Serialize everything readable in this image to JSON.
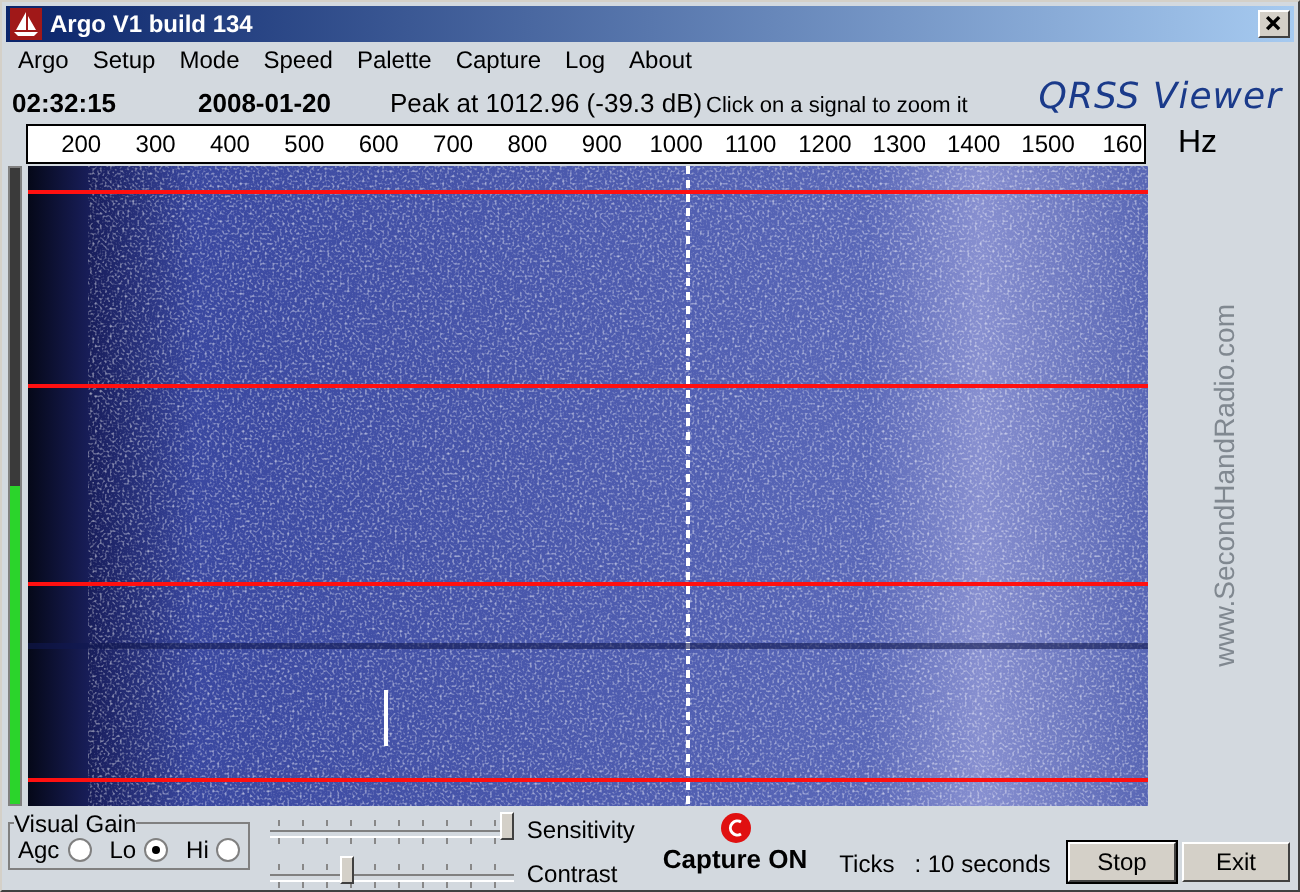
{
  "window": {
    "title": "Argo V1 build 134"
  },
  "menu": [
    {
      "label": "Argo"
    },
    {
      "label": "Setup"
    },
    {
      "label": "Mode"
    },
    {
      "label": "Speed"
    },
    {
      "label": "Palette"
    },
    {
      "label": "Capture"
    },
    {
      "label": "Log"
    },
    {
      "label": "About"
    }
  ],
  "info": {
    "time": "02:32:15",
    "date": "2008-01-20",
    "peak": "Peak at 1012.96 (-39.3 dB)",
    "hint": "Click on a signal to zoom it",
    "logo": "QRSS Viewer"
  },
  "scale": {
    "ticks": [
      "200",
      "300",
      "400",
      "500",
      "600",
      "700",
      "800",
      "900",
      "1000",
      "1100",
      "1200",
      "1300",
      "1400",
      "1500",
      "160"
    ],
    "unit": "Hz"
  },
  "meter": {
    "level": 0.5
  },
  "side_text": "www.SecondHandRadio.com",
  "visual_gain": {
    "title": "Visual Gain",
    "options": [
      {
        "label": "Agc",
        "selected": false
      },
      {
        "label": "Lo",
        "selected": true
      },
      {
        "label": "Hi",
        "selected": false
      }
    ]
  },
  "sliders": [
    {
      "label": "Sensitivity",
      "level": 1
    },
    {
      "label": "Contrast",
      "level": 0.3
    }
  ],
  "capture": {
    "on": true,
    "label": "Capture ON"
  },
  "ticks": {
    "label": "Ticks",
    "value": ": 10 seconds"
  },
  "buttons": [
    {
      "label": "Stop"
    },
    {
      "label": "Exit"
    }
  ]
}
